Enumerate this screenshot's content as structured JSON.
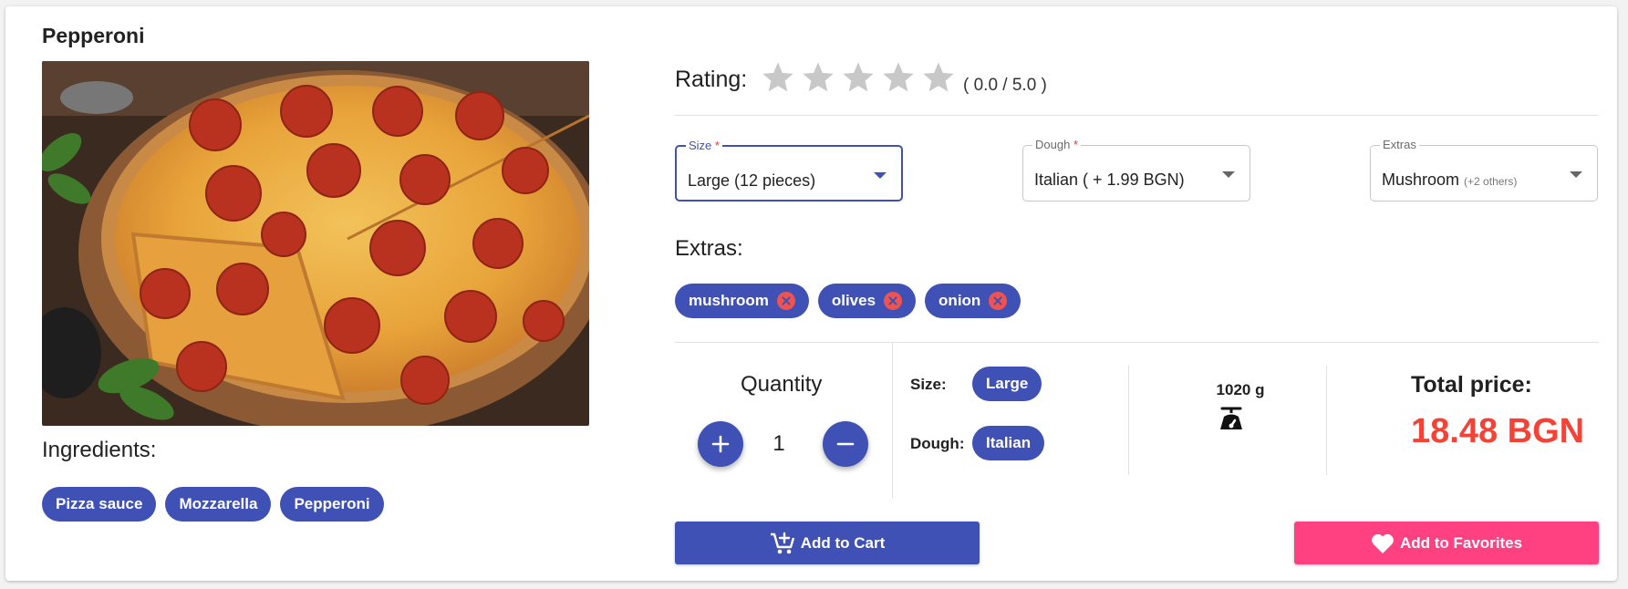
{
  "product": {
    "title": "Pepperoni",
    "ingredients_heading": "Ingredients:",
    "ingredients": [
      "Pizza sauce",
      "Mozzarella",
      "Pepperoni"
    ]
  },
  "rating": {
    "label": "Rating:",
    "value_text": "( 0.0 / 5.0 )",
    "stars_filled": 0,
    "stars_total": 5
  },
  "selects": {
    "size": {
      "label": "Size",
      "required_mark": "*",
      "value": "Large (12 pieces)"
    },
    "dough": {
      "label": "Dough",
      "required_mark": "*",
      "value": "Italian ( + 1.99 BGN)"
    },
    "extras": {
      "label": "Extras",
      "value": "Mushroom",
      "more": "(+2 others)"
    }
  },
  "extras": {
    "heading": "Extras:",
    "items": [
      "mushroom",
      "olives",
      "onion"
    ]
  },
  "quantity": {
    "label": "Quantity",
    "value": "1"
  },
  "summary": {
    "size_label": "Size:",
    "size_value": "Large",
    "dough_label": "Dough:",
    "dough_value": "Italian",
    "weight": "1020 g"
  },
  "total": {
    "label": "Total price:",
    "value": "18.48 BGN"
  },
  "actions": {
    "add_to_cart": "Add to Cart",
    "add_to_favorites": "Add to Favorites"
  },
  "colors": {
    "primary": "#3f51b5",
    "accent": "#ff4081",
    "price": "#f44336",
    "chip_remove": "#ef5350"
  },
  "icons": [
    "star-icon",
    "dropdown-arrow-icon",
    "remove-chip-icon",
    "plus-icon",
    "minus-icon",
    "scale-icon",
    "cart-add-icon",
    "heart-icon"
  ]
}
